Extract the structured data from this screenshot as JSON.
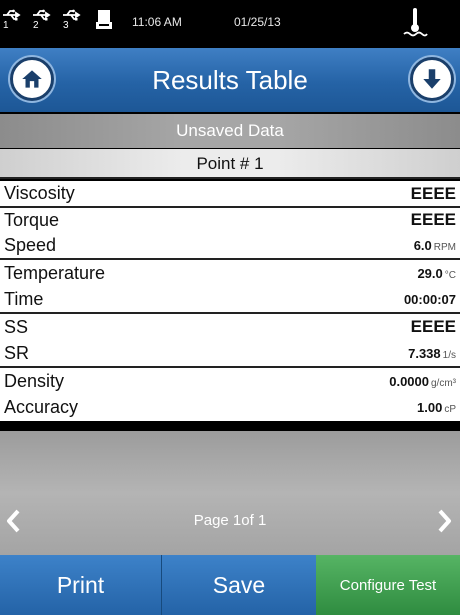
{
  "status_bar": {
    "usb_ports": [
      "1",
      "2",
      "3"
    ],
    "time": "11:06 AM",
    "date": "01/25/13"
  },
  "header": {
    "title": "Results Table",
    "home_icon": "home-icon",
    "down_icon": "arrow-down-icon"
  },
  "banner": "Unsaved Data",
  "point_label": "Point # 1",
  "rows": [
    {
      "label": "Viscosity",
      "value": "EEEE",
      "unit": ""
    },
    {
      "label": "Torque",
      "value": "EEEE",
      "unit": ""
    },
    {
      "label": "Speed",
      "value": "6.0",
      "unit": "RPM"
    },
    {
      "label": "Temperature",
      "value": "29.0",
      "unit": "°C"
    },
    {
      "label": "Time",
      "value": "00:00:07",
      "unit": ""
    },
    {
      "label": "SS",
      "value": "EEEE",
      "unit": ""
    },
    {
      "label": "SR",
      "value": "7.338",
      "unit": "1/s"
    },
    {
      "label": "Density",
      "value": "0.0000",
      "unit": "g/cm³"
    },
    {
      "label": "Accuracy",
      "value": "1.00",
      "unit": "cP"
    }
  ],
  "pager": {
    "text": "Page 1of 1"
  },
  "buttons": {
    "print": "Print",
    "save": "Save",
    "configure": "Configure Test"
  },
  "colors": {
    "header_blue": "#2563a6",
    "configure_green": "#3a9a4b"
  }
}
